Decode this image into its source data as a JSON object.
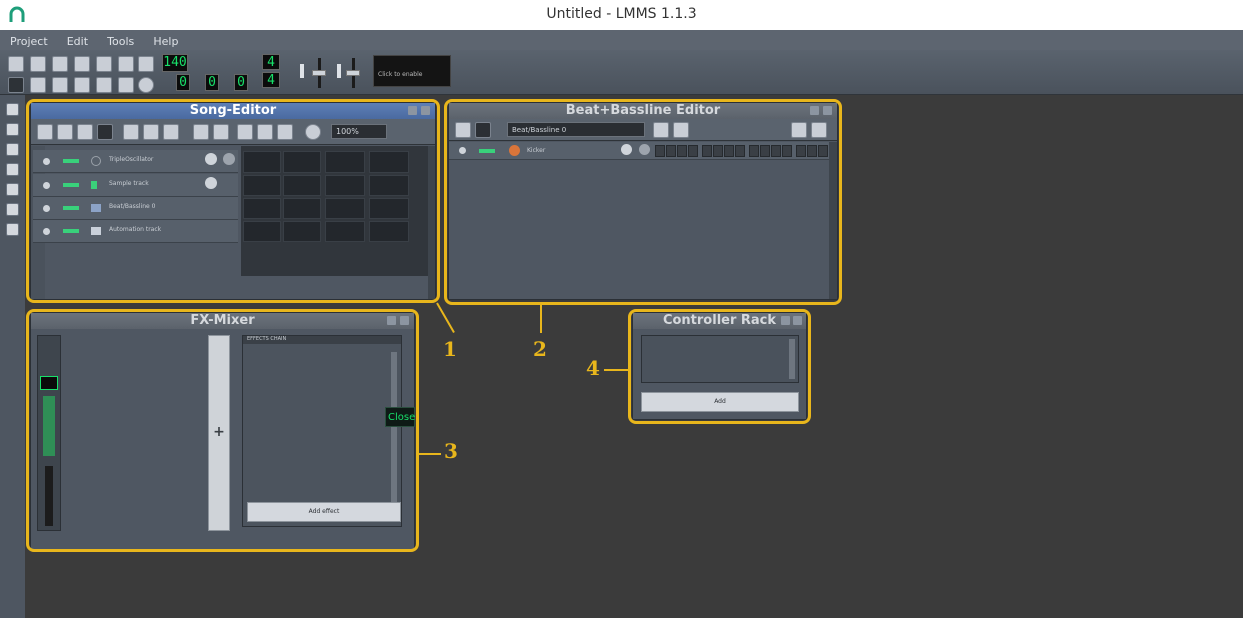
{
  "window": {
    "title": "Untitled - LMMS 1.1.3"
  },
  "menubar": {
    "items": [
      "Project",
      "Edit",
      "Tools",
      "Help"
    ]
  },
  "toolbar": {
    "tempo_lcd": "140",
    "time_sig_top": "4",
    "time_sig_bottom": "4",
    "time_min": "0",
    "time_sec": "0",
    "time_msec": "0",
    "cpu_graph_label": "Click to enable"
  },
  "song_editor": {
    "title": "Song-Editor",
    "zoom": "100%",
    "tracks": [
      "TripleOscillator",
      "Sample track",
      "Beat/Bassline 0",
      "Automation track"
    ]
  },
  "beat_bassline_editor": {
    "title": "Beat+Bassline Editor",
    "selected_pattern": "Beat/Bassline 0",
    "track_name": "Kicker"
  },
  "fx_mixer": {
    "title": "FX-Mixer",
    "effects_header": "EFFECTS CHAIN",
    "add_effect_label": "Add effect",
    "close_tooltip": "Close"
  },
  "controller_rack": {
    "title": "Controller Rack",
    "add_label": "Add"
  },
  "callouts": {
    "n1": "1",
    "n2": "2",
    "n3": "3",
    "n4": "4"
  },
  "colors": {
    "highlight": "#e8b61c",
    "lcd_green": "#18e06a",
    "workspace_bg": "#3b3b3b"
  }
}
